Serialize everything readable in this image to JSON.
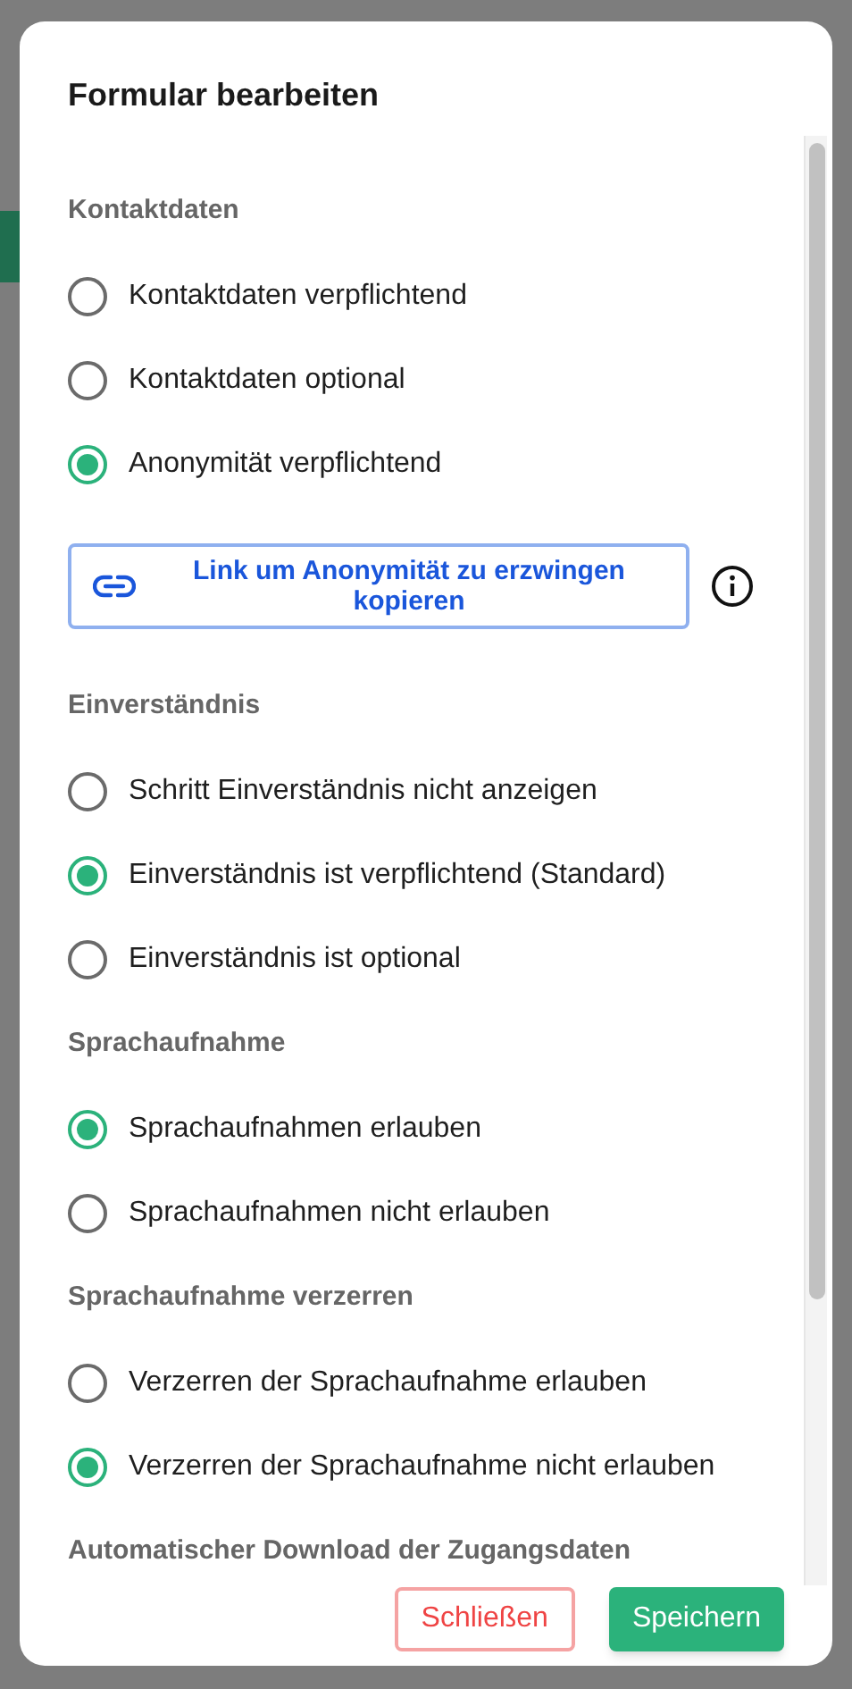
{
  "dialog": {
    "title": "Formular bearbeiten",
    "sections": [
      {
        "heading": "Kontaktdaten",
        "options": [
          {
            "label": "Kontaktdaten verpflichtend",
            "selected": false
          },
          {
            "label": "Kontaktdaten optional",
            "selected": false
          },
          {
            "label": "Anonymität verpflichtend",
            "selected": true
          }
        ],
        "action": {
          "label": "Link um Anonymität zu erzwingen kopieren"
        }
      },
      {
        "heading": "Einverständnis",
        "options": [
          {
            "label": "Schritt Einverständnis nicht anzeigen",
            "selected": false
          },
          {
            "label": "Einverständnis ist verpflichtend (Standard)",
            "selected": true
          },
          {
            "label": "Einverständnis ist optional",
            "selected": false
          }
        ]
      },
      {
        "heading": "Sprachaufnahme",
        "options": [
          {
            "label": "Sprachaufnahmen erlauben",
            "selected": true
          },
          {
            "label": "Sprachaufnahmen nicht erlauben",
            "selected": false
          }
        ]
      },
      {
        "heading": "Sprachaufnahme verzerren",
        "options": [
          {
            "label": "Verzerren der Sprachaufnahme erlauben",
            "selected": false
          },
          {
            "label": "Verzerren der Sprachaufnahme nicht erlauben",
            "selected": true
          }
        ]
      },
      {
        "heading": "Automatischer Download der Zugangsdaten"
      }
    ],
    "buttons": [
      {
        "label": "Schließen",
        "kind": "secondary"
      },
      {
        "label": "Speichern",
        "kind": "primary"
      }
    ]
  }
}
